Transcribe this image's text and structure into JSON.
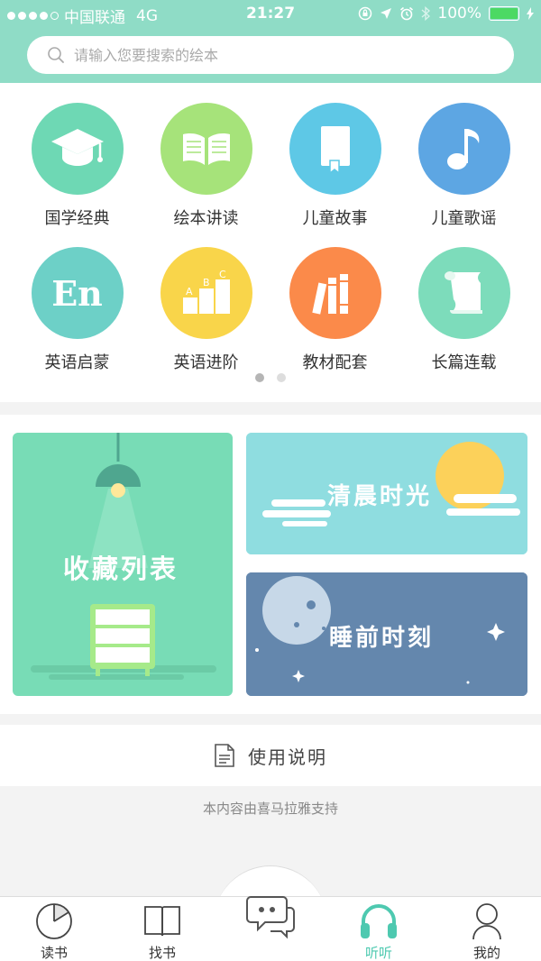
{
  "status": {
    "carrier": "中国联通",
    "network": "4G",
    "time": "21:27",
    "battery": "100%"
  },
  "search": {
    "placeholder": "请输入您要搜索的绘本"
  },
  "categories": [
    {
      "label": "国学经典",
      "icon": "graduation-cap-icon",
      "color": "#6ed8b4"
    },
    {
      "label": "绘本讲读",
      "icon": "open-book-icon",
      "color": "#a6e37a"
    },
    {
      "label": "儿童故事",
      "icon": "bookmark-book-icon",
      "color": "#5ec8e6"
    },
    {
      "label": "儿童歌谣",
      "icon": "music-note-icon",
      "color": "#5da6e3"
    },
    {
      "label": "英语启蒙",
      "icon": "english-en-icon",
      "color": "#6dd0c7"
    },
    {
      "label": "英语进阶",
      "icon": "abc-steps-icon",
      "color": "#f9d54a"
    },
    {
      "label": "教材配套",
      "icon": "books-icon",
      "color": "#fb8a4a"
    },
    {
      "label": "长篇连载",
      "icon": "scroll-icon",
      "color": "#7ddcbb"
    }
  ],
  "pager": {
    "pages": 2,
    "current": 1
  },
  "cards": {
    "favorites": {
      "title": "收藏列表",
      "color": "#78dcb6"
    },
    "morning": {
      "title": "清晨时光",
      "color": "#8fdde0"
    },
    "bedtime": {
      "title": "睡前时刻",
      "color": "#6487ad"
    }
  },
  "usage": {
    "label": "使用说明"
  },
  "provider": "本内容由喜马拉雅支持",
  "tabs": [
    {
      "label": "读书",
      "icon": "reading-chart-icon"
    },
    {
      "label": "找书",
      "icon": "find-book-icon"
    },
    {
      "label": "",
      "icon": "chat-bubbles-icon"
    },
    {
      "label": "听听",
      "icon": "headphones-icon",
      "active": true
    },
    {
      "label": "我的",
      "icon": "profile-icon"
    }
  ],
  "colors": {
    "accent": "#4ec9b0",
    "header": "#8fdcc6"
  }
}
